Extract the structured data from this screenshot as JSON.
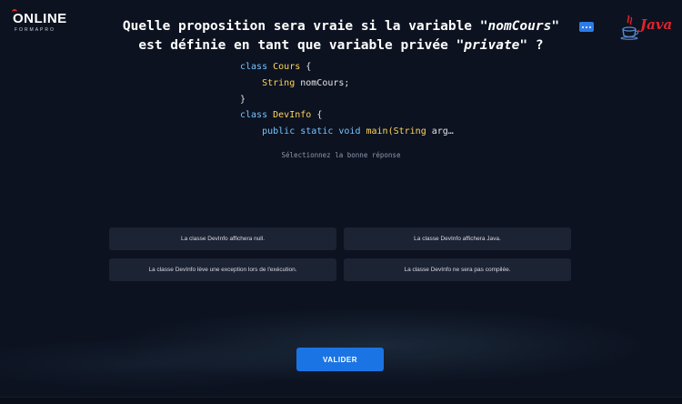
{
  "brand": {
    "logo_main": "ONLINE",
    "logo_sub": "FORMAPRO"
  },
  "question": {
    "part1": "Quelle proposition sera vraie si la variable \"",
    "var_name": "nomCours",
    "part2": "\" est définie en tant que variable privée \"",
    "modifier": "private",
    "part3": "\" ?"
  },
  "java_logo": {
    "text": "Java"
  },
  "code": {
    "l1_kw": "class",
    "l1_cl": "Cours",
    "l1_rest": " {",
    "l2_indent": "    ",
    "l2_type": "String",
    "l2_rest": " nomCours;",
    "l3": "}",
    "l4_kw": "class",
    "l4_cl": "DevInfo",
    "l4_rest": " {",
    "l5_indent": "    ",
    "l5_kw": "public static void",
    "l5_name": " main(",
    "l5_type": "String",
    "l5_rest": " arg…"
  },
  "hint": "Sélectionnez la bonne réponse",
  "answers": [
    "La classe DevInfo affichera null.",
    "La classe DevInfo affichera Java.",
    "La classe DevInfo lève une exception lors de l'exécution.",
    "La classe DevInfo ne sera pas compilée."
  ],
  "submit_label": "VALIDER",
  "colors": {
    "background": "#0c1220",
    "accent_blue": "#1b74e4",
    "keyword": "#78c4ff",
    "class_name": "#ffd65a",
    "brand_red": "#e0242c"
  }
}
